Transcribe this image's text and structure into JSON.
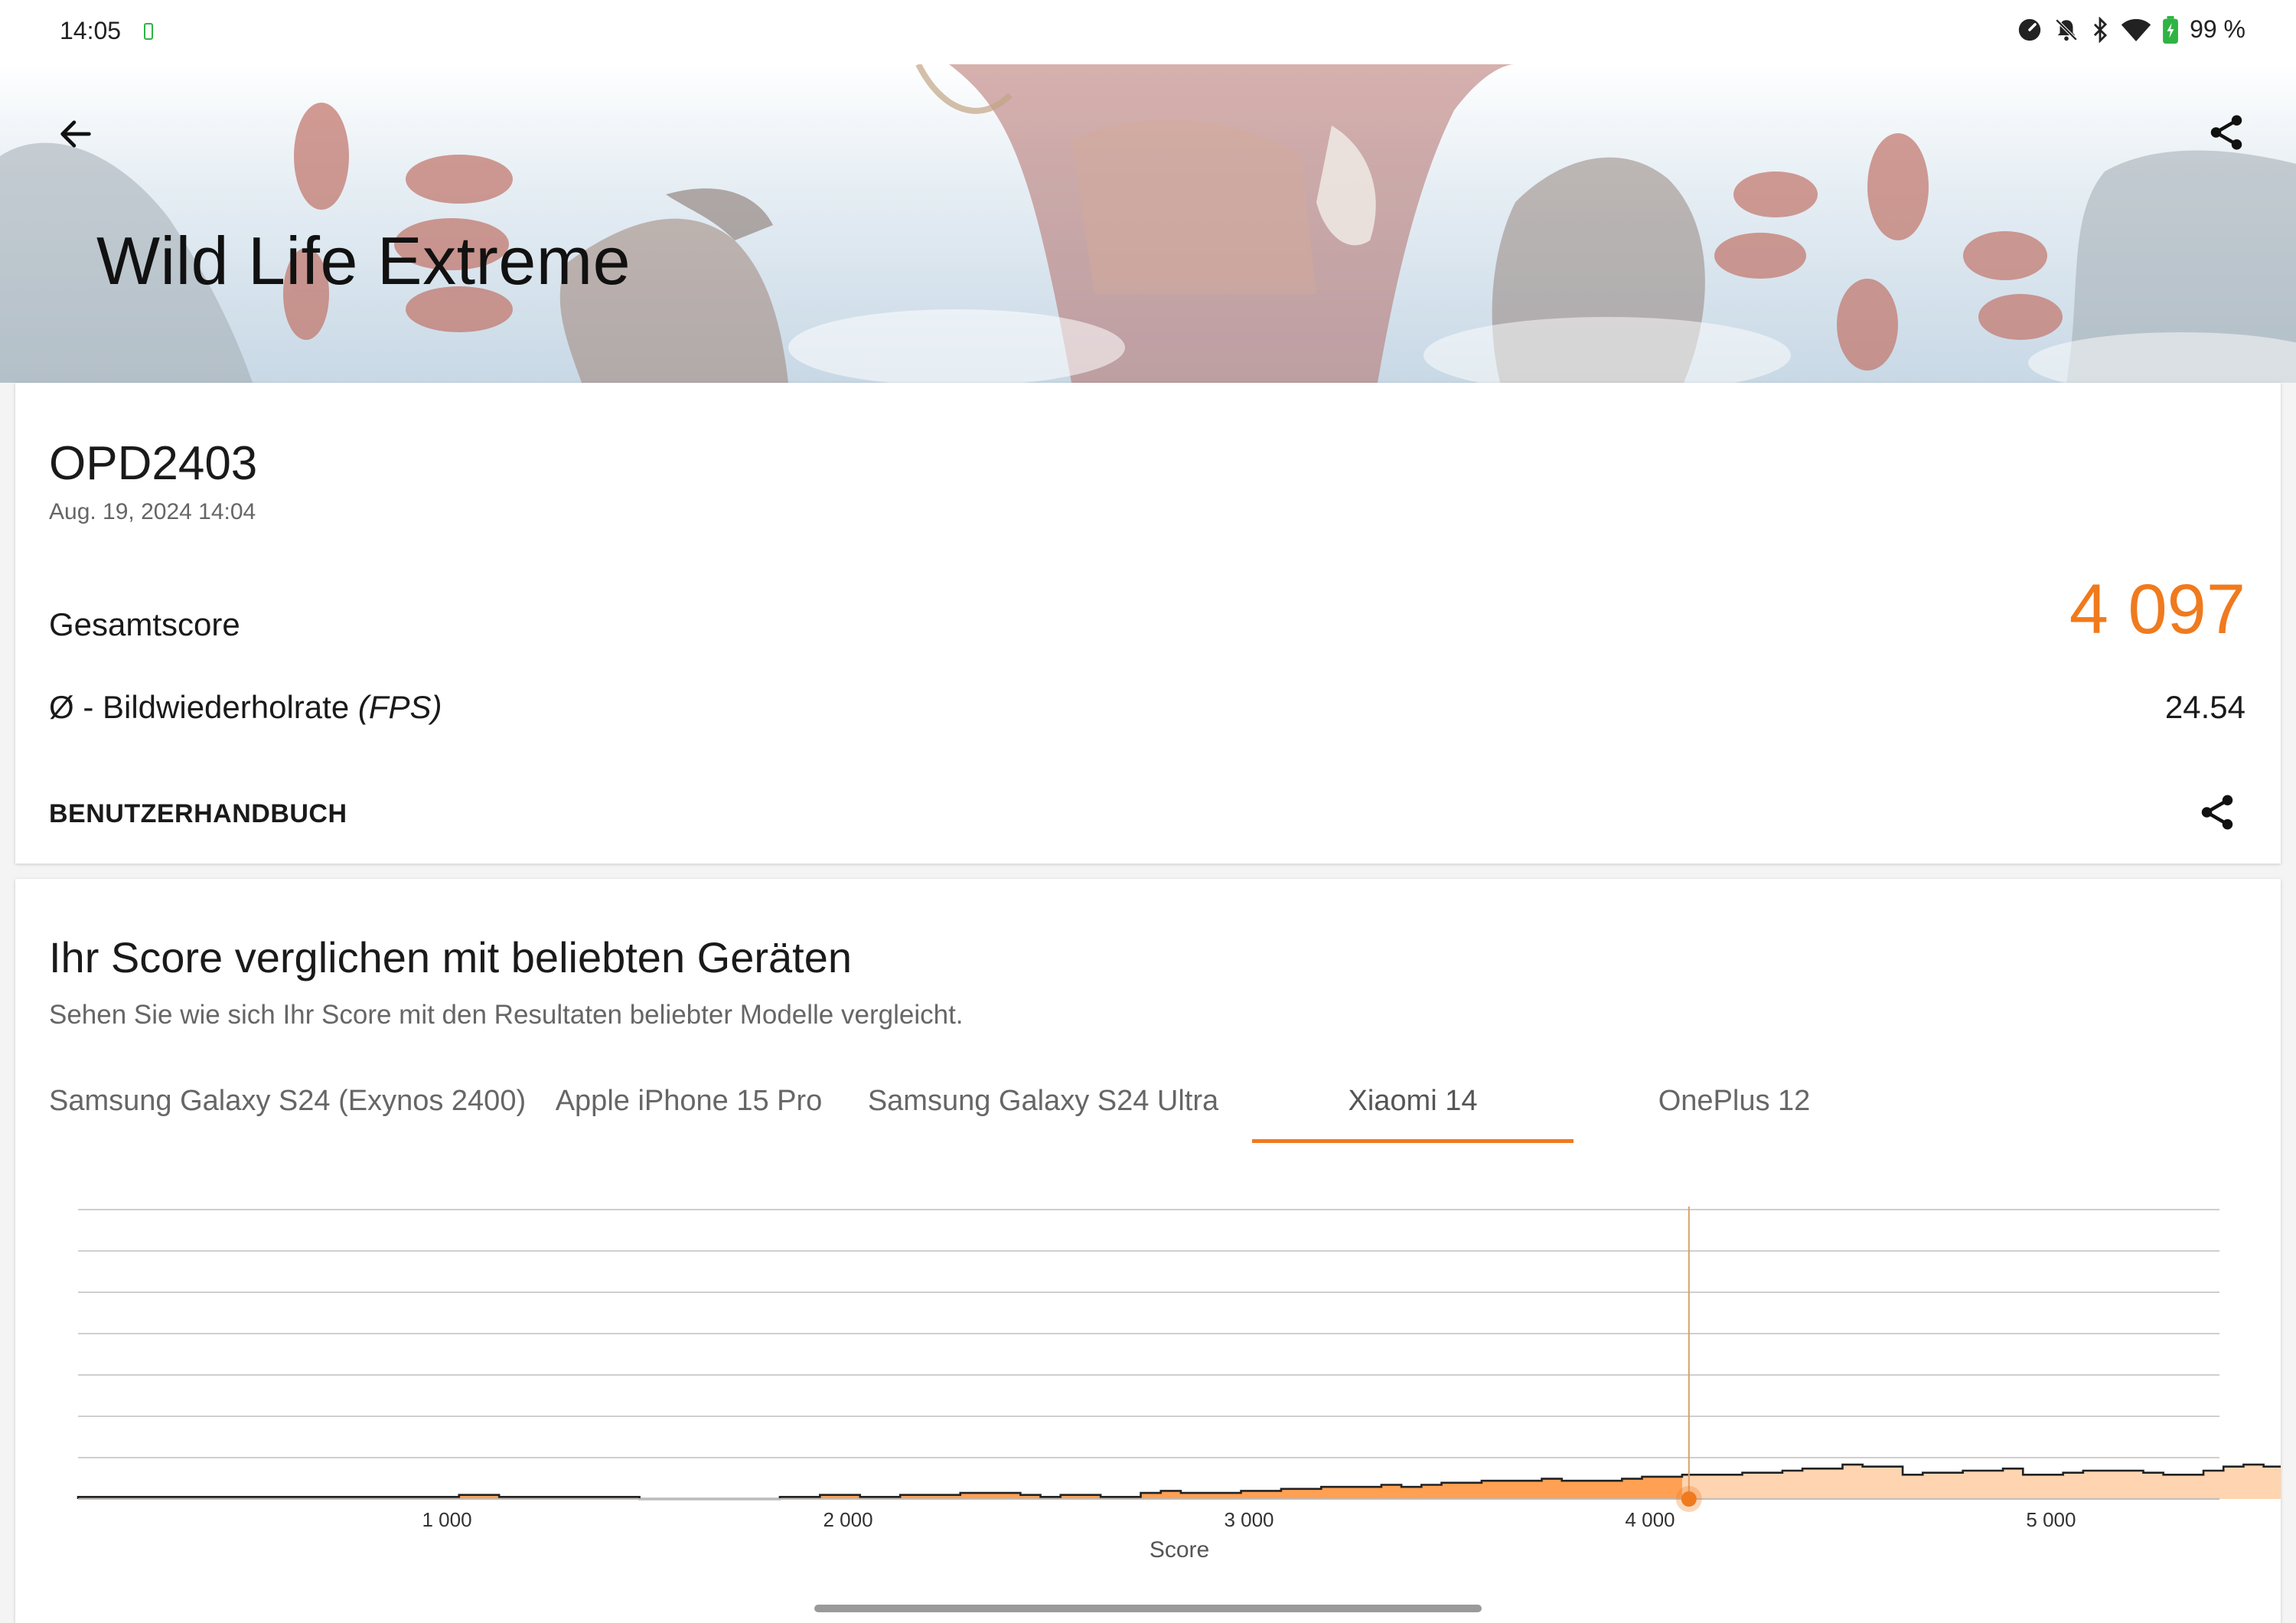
{
  "status_bar": {
    "time": "14:05",
    "battery_percent": "99 %",
    "icons": [
      "data-saver-icon",
      "notifications-off-icon",
      "bluetooth-icon",
      "wifi-icon",
      "battery-charging-icon"
    ]
  },
  "header": {
    "title": "Wild Life Extreme",
    "back_icon": "arrow-left-icon",
    "share_icon": "share-icon"
  },
  "result": {
    "device": "OPD2403",
    "datetime": "Aug. 19, 2024 14:04",
    "total_label": "Gesamtscore",
    "total_score": "4 097",
    "fps_label_prefix": "Ø - Bildwiederholrate ",
    "fps_label_unit": "(FPS)",
    "fps_value": "24.54",
    "manual_link": "BENUTZERHANDBUCH"
  },
  "comparison": {
    "title": "Ihr Score verglichen mit beliebten Geräten",
    "subtitle": "Sehen Sie wie sich Ihr Score mit den Resultaten beliebter Modelle vergleicht.",
    "tabs": [
      {
        "label": "Samsung Galaxy S24 (Exynos 2400)",
        "active": false
      },
      {
        "label": "Apple iPhone 15 Pro",
        "active": false
      },
      {
        "label": "Samsung Galaxy S24 Ultra",
        "active": false
      },
      {
        "label": "Xiaomi 14",
        "active": true
      },
      {
        "label": "OnePlus 12",
        "active": false
      }
    ]
  },
  "colors": {
    "accent": "#f07a1e",
    "bar_dark": "#ffa052",
    "bar_light": "#ffd4b0"
  },
  "chart_data": {
    "type": "histogram",
    "xlabel": "Score",
    "xlim": [
      80,
      5420
    ],
    "xticks": [
      1000,
      2000,
      3000,
      4000,
      5000
    ],
    "xtick_labels": [
      "1 000",
      "2 000",
      "3 000",
      "4 000",
      "5 000"
    ],
    "grid": true,
    "your_score": 4097,
    "bin_width": 50,
    "bin_start": 80,
    "frequencies": [
      1,
      1,
      1,
      1,
      1,
      1,
      1,
      1,
      1,
      1,
      1,
      1,
      1,
      1,
      1,
      1,
      1,
      1,
      1,
      2,
      2,
      1,
      1,
      1,
      1,
      1,
      1,
      1,
      0,
      0,
      0,
      0,
      0,
      0,
      0,
      1,
      1,
      2,
      2,
      1,
      1,
      2,
      2,
      2,
      3,
      3,
      3,
      2,
      1,
      2,
      2,
      1,
      1,
      3,
      4,
      3,
      3,
      3,
      4,
      4,
      5,
      5,
      6,
      6,
      6,
      7,
      6,
      7,
      8,
      8,
      9,
      9,
      9,
      10,
      9,
      9,
      9,
      10,
      11,
      11,
      12,
      12,
      12,
      13,
      13,
      14,
      15,
      15,
      17,
      16,
      16,
      12,
      13,
      13,
      14,
      14,
      15,
      12,
      12,
      13,
      14,
      14,
      14,
      13,
      12,
      12,
      14,
      16,
      17,
      16,
      14,
      12,
      9,
      14,
      17,
      21,
      25,
      26,
      29,
      31,
      34,
      36,
      42,
      49,
      56,
      64,
      74,
      88,
      108,
      88,
      100,
      112,
      122,
      128,
      132,
      130,
      126,
      122,
      118,
      116,
      114,
      115,
      116,
      113,
      114,
      112,
      112,
      115,
      114,
      110,
      108,
      108,
      106,
      104,
      100,
      92,
      89,
      95,
      98,
      103,
      110,
      60,
      10,
      4
    ]
  }
}
